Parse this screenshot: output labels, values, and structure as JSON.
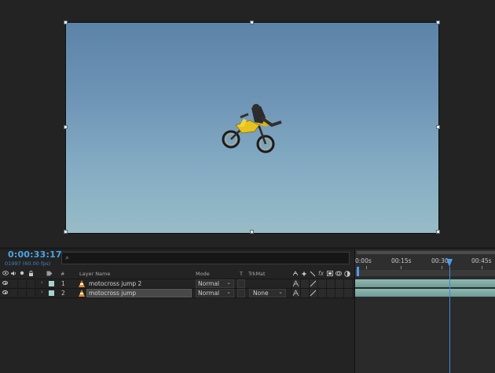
{
  "viewer": {
    "subject_icon": "motocross-rider-icon"
  },
  "timeline": {
    "timecode": "0:00:33:17",
    "fps_readout": "01997 (60.00 fps)",
    "search": {
      "value": "",
      "icon": "search-icon"
    },
    "columns": {
      "num": "#",
      "layer_name": "Layer Name",
      "mode": "Mode",
      "t": "T",
      "trkmat": "TrkMat",
      "fx": "fx"
    },
    "layers": [
      {
        "num": "1",
        "name": "motocross jump 2",
        "mode": "Normal",
        "trkmat": "",
        "label_color": "#a7d3cf",
        "selected": false
      },
      {
        "num": "2",
        "name": "motocross jump",
        "mode": "Normal",
        "trkmat": "None",
        "label_color": "#a7d3cf",
        "selected": true
      }
    ],
    "ruler": {
      "ticks": [
        "0:00s",
        "00:15s",
        "00:30s",
        "00:45s"
      ]
    },
    "colors": {
      "accent": "#4a9eef",
      "clip": "#8fb8b2"
    }
  }
}
